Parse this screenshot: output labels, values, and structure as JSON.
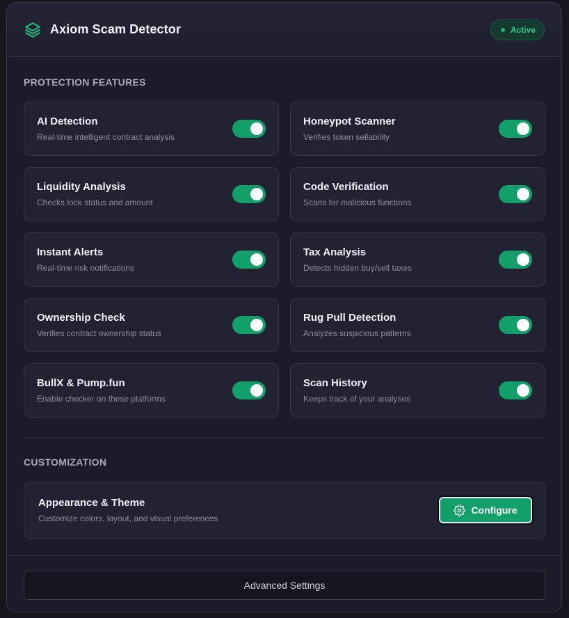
{
  "header": {
    "title": "Axiom Scam Detector",
    "status": "Active",
    "icon": "layers-icon"
  },
  "protection": {
    "section_title": "PROTECTION FEATURES",
    "features": [
      {
        "title": "AI Detection",
        "desc": "Real-time intelligent contract analysis",
        "enabled": true
      },
      {
        "title": "Honeypot Scanner",
        "desc": "Verifies token sellability",
        "enabled": true
      },
      {
        "title": "Liquidity Analysis",
        "desc": "Checks lock status and amount",
        "enabled": true
      },
      {
        "title": "Code Verification",
        "desc": "Scans for malicious functions",
        "enabled": true
      },
      {
        "title": "Instant Alerts",
        "desc": "Real-time risk notifications",
        "enabled": true
      },
      {
        "title": "Tax Analysis",
        "desc": "Detects hidden buy/sell taxes",
        "enabled": true
      },
      {
        "title": "Ownership Check",
        "desc": "Verifies contract ownership status",
        "enabled": true
      },
      {
        "title": "Rug Pull Detection",
        "desc": "Analyzes suspicious patterns",
        "enabled": true
      },
      {
        "title": "BullX & Pump.fun",
        "desc": "Enable checker on these platforms",
        "enabled": true
      },
      {
        "title": "Scan History",
        "desc": "Keeps track of your analyses",
        "enabled": true
      }
    ]
  },
  "customization": {
    "section_title": "CUSTOMIZATION",
    "card_title": "Appearance & Theme",
    "card_desc": "Customize colors, layout, and visual preferences",
    "configure_label": "Configure"
  },
  "footer": {
    "advanced_label": "Advanced Settings"
  },
  "colors": {
    "accent": "#12a06a",
    "status_text": "#2ecc8a",
    "background": "#1b1b29",
    "card": "#222232"
  }
}
